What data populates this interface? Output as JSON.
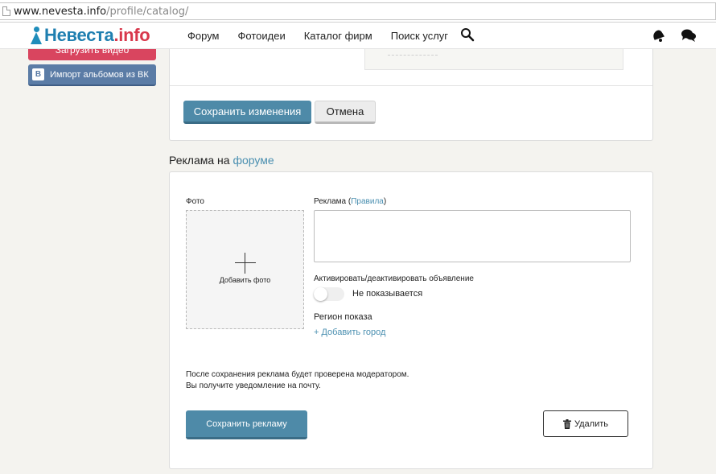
{
  "browser": {
    "url_host": "www.nevesta.info",
    "url_path": "/profile/catalog/"
  },
  "header": {
    "logo_name": "Невеста",
    "logo_suffix": ".info",
    "nav": [
      "Форум",
      "Фотоидеи",
      "Каталог фирм",
      "Поиск услуг"
    ]
  },
  "sidebar": {
    "video_button": "Загрузить видео",
    "vk_badge": "B",
    "vk_button": "Импорт альбомов из ВК"
  },
  "top_card": {
    "save_changes": "Сохранить изменения",
    "cancel": "Отмена"
  },
  "ad_section": {
    "title_prefix": "Реклама на",
    "title_link": "форуме",
    "photo_label": "Фото",
    "add_photo": "Добавить фото",
    "ad_label": "Реклама (",
    "rules_link": "Правила",
    "ad_label_close": ")",
    "ad_text_value": "",
    "activate_label": "Активировать/деактивировать объявление",
    "toggle_state_text": "Не показывается",
    "toggle_on": false,
    "region_label": "Регион показа",
    "add_city": "+ Добавить город",
    "note_line1": "После сохранения реклама будет проверена модератором.",
    "note_line2": "Вы получите уведомление на почту.",
    "save_ad": "Сохранить рекламу",
    "delete": "Удалить"
  }
}
